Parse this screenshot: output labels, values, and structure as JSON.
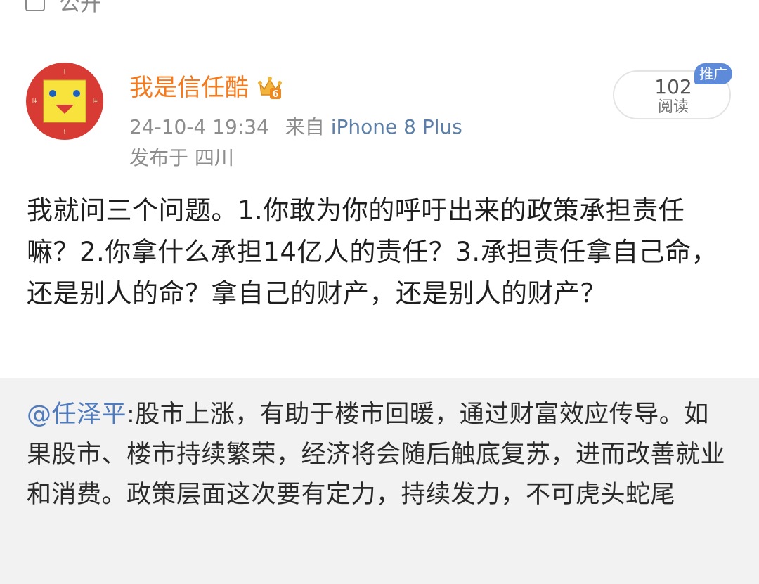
{
  "top": {
    "label": "公开"
  },
  "user": {
    "name": "我是信任酷",
    "vip_badge": "6"
  },
  "meta": {
    "datetime": "24-10-4 19:34",
    "from_prefix": "来自",
    "device": "iPhone 8 Plus"
  },
  "location": "发布于 四川",
  "read": {
    "count": "102",
    "label": "阅读",
    "badge": "推广"
  },
  "post": {
    "text": "我就问三个问题。1.你敢为你的呼吁出来的政策承担责任嘛？2.你拿什么承担14亿人的责任？3.承担责任拿自己命，还是别人的命？拿自己的财产，还是别人的财产？"
  },
  "repost": {
    "mention": "@任泽平",
    "text": ":股市上涨，有助于楼市回暖，通过财富效应传导。如果股市、楼市持续繁荣，经济将会随后触底复苏，进而改善就业和消费。政策层面这次要有定力，持续发力，不可虎头蛇尾"
  },
  "colors": {
    "username": "#f57a1c",
    "link": "#5b7fa8",
    "mention": "#4f7bbd",
    "promo_badge": "#5e8bd9",
    "repost_bg": "#f2f2f2",
    "avatar_bg": "#d83b34",
    "avatar_face": "#f7e33c"
  },
  "icons": {
    "avatar": "yellow-square-face-avatar",
    "vip": "crown-icon",
    "checkbox": "checkbox-icon"
  }
}
